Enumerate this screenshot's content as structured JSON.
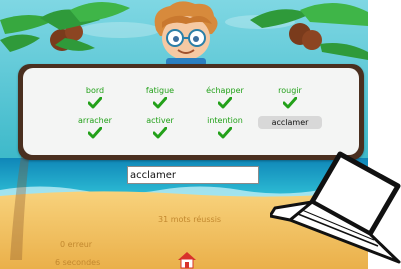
{
  "game": {
    "words": [
      {
        "text": "bord",
        "status": "done"
      },
      {
        "text": "fatigue",
        "status": "done"
      },
      {
        "text": "échapper",
        "status": "done"
      },
      {
        "text": "rougir",
        "status": "done"
      },
      {
        "text": "arracher",
        "status": "done"
      },
      {
        "text": "activer",
        "status": "done"
      },
      {
        "text": "intention",
        "status": "done"
      },
      {
        "text": "acclamer",
        "status": "current"
      }
    ],
    "input_value": "acclamer",
    "success_text": "31 mots réussis",
    "errors_text": "0 erreur",
    "time_text": "6 secondes"
  },
  "colors": {
    "sky": "#2fb8c9",
    "sea": "#1fa6c4",
    "sand": "#f5c35a",
    "board_frame": "#4a2f1f",
    "word_done": "#23a11a",
    "stat_text": "#c2882f"
  },
  "icons": {
    "check": "check-icon",
    "home": "home-icon",
    "laptop": "laptop-icon",
    "mascot": "boy-with-glasses-mascot"
  }
}
